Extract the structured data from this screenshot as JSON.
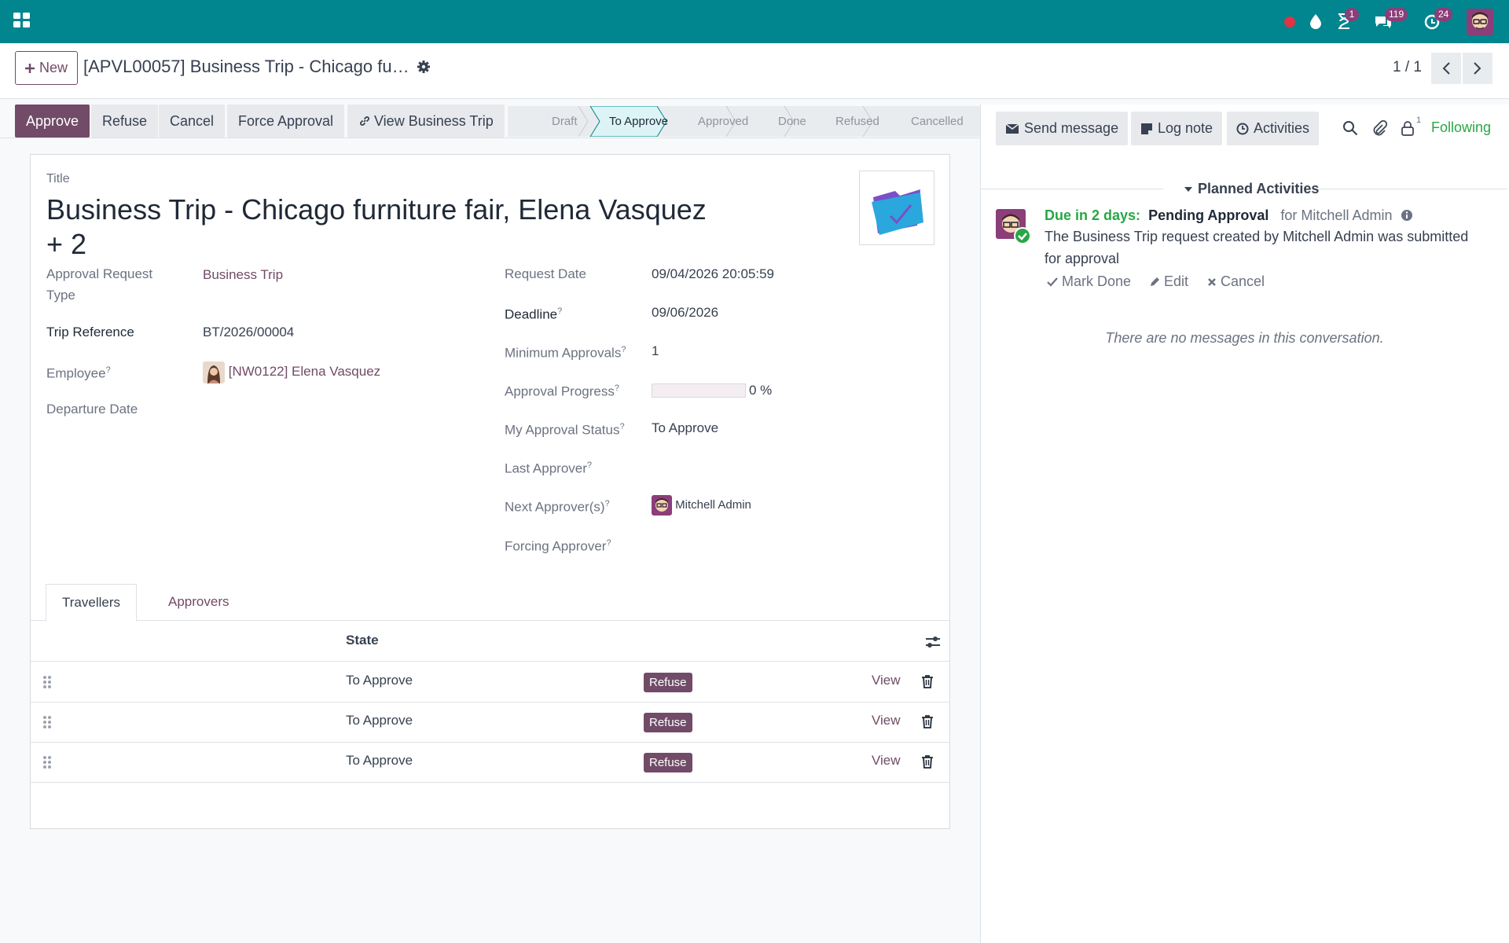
{
  "navbar": {
    "bg_color": "#01858e",
    "icons": [
      "apps-grid-icon",
      "record-icon",
      "drop-icon",
      "hourglass-icon",
      "chat-icon",
      "refresh-icon"
    ],
    "activity_badge": "1",
    "messages_badge": "119",
    "updates_badge": "24"
  },
  "control_panel": {
    "new_label": "New",
    "breadcrumb": "[APVL00057] Business Trip - Chicago furni...",
    "pager_value": "1 / 1"
  },
  "statusbar": {
    "buttons": [
      "Approve",
      "Refuse",
      "Cancel",
      "Force Approval",
      "View Business Trip"
    ],
    "stages": [
      "Draft",
      "To Approve",
      "Approved",
      "Done",
      "Refused",
      "Cancelled"
    ],
    "active_stage": "To Approve",
    "accent_color": "#714b67"
  },
  "form": {
    "title_label": "Title",
    "title": "Business Trip - Chicago furniture fair, Elena Vasquez + 2",
    "left_fields": [
      {
        "label": "Approval Request Type",
        "value": "Business Trip"
      },
      {
        "label": "Trip Reference",
        "value": "BT/2026/00004"
      },
      {
        "label": "Employee",
        "value": "[NW0122] Elena Vasquez"
      },
      {
        "label": "Departure Date",
        "value": ""
      }
    ],
    "right_fields": [
      {
        "label": "Request Date",
        "value": "09/04/2026 20:05:59"
      },
      {
        "label": "Deadline",
        "value": "09/06/2026"
      },
      {
        "label": "Minimum Approvals",
        "value": "1"
      },
      {
        "label": "Approval Progress",
        "value": "0 %",
        "progress": 0
      },
      {
        "label": "My Approval Status",
        "value": "To Approve"
      },
      {
        "label": "Last Approver",
        "value": ""
      },
      {
        "label": "Next Approver(s)",
        "value": "Mitchell Admin"
      },
      {
        "label": "Forcing Approver",
        "value": ""
      }
    ],
    "tooltip_mark": "?",
    "tabs": [
      "Travellers",
      "Approvers"
    ],
    "list": {
      "header_state": "State",
      "rows": [
        {
          "state": "To Approve",
          "badge": "Refuse",
          "view": "View"
        },
        {
          "state": "To Approve",
          "badge": "Refuse",
          "view": "View"
        },
        {
          "state": "To Approve",
          "badge": "Refuse",
          "view": "View"
        }
      ]
    }
  },
  "chatter": {
    "send_message": "Send message",
    "log_note": "Log note",
    "activities": "Activities",
    "follower_count": "1",
    "following": "Following",
    "planned_title": "Planned Activities",
    "activity": {
      "due": "Due in 2 days:",
      "summary": "Pending Approval",
      "for_who": "for Mitchell Admin",
      "description": "The Business Trip request created by Mitchell Admin was submitted for approval",
      "mark_done": "Mark Done",
      "edit": "Edit",
      "cancel": "Cancel"
    },
    "no_messages": "There are no messages in this conversation."
  }
}
